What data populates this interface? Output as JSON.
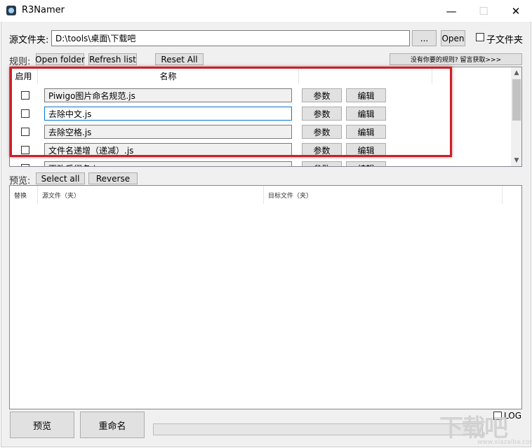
{
  "window": {
    "title": "R3Namer",
    "min": "—",
    "max": "☐",
    "close": "✕"
  },
  "source": {
    "label": "源文件夹:",
    "path": "D:\\tools\\桌面\\下载吧",
    "browse": "...",
    "open": "Open",
    "subfolder_label": "子文件夹"
  },
  "rules_bar": {
    "label": "规则:",
    "open_folder": "Open folder",
    "refresh": "Refresh list",
    "reset": "Reset All",
    "more_link": "没有你要的规则? 留言获取>>>"
  },
  "rules_table": {
    "columns": [
      "启用",
      "名称"
    ],
    "rows": [
      {
        "name": "Piwigo图片命名规范.js",
        "params": "参数",
        "edit": "编辑"
      },
      {
        "name": "去除中文.js",
        "params": "参数",
        "edit": "编辑"
      },
      {
        "name": "去除空格.js",
        "params": "参数",
        "edit": "编辑"
      },
      {
        "name": "文件名递增（递减）.js",
        "params": "参数",
        "edit": "编辑"
      },
      {
        "name": "更改后缀名.js",
        "params": "参数",
        "edit": "编辑"
      }
    ]
  },
  "preview_bar": {
    "label": "预览:",
    "select_all": "Select all",
    "reverse": "Reverse"
  },
  "preview_table": {
    "columns": [
      "替换",
      "源文件（夹）",
      "目标文件（夹）"
    ]
  },
  "footer": {
    "preview": "预览",
    "rename": "重命名",
    "log": "LOG"
  },
  "watermark": {
    "text": "下载吧",
    "sub": "www.xiazaiba.com"
  }
}
